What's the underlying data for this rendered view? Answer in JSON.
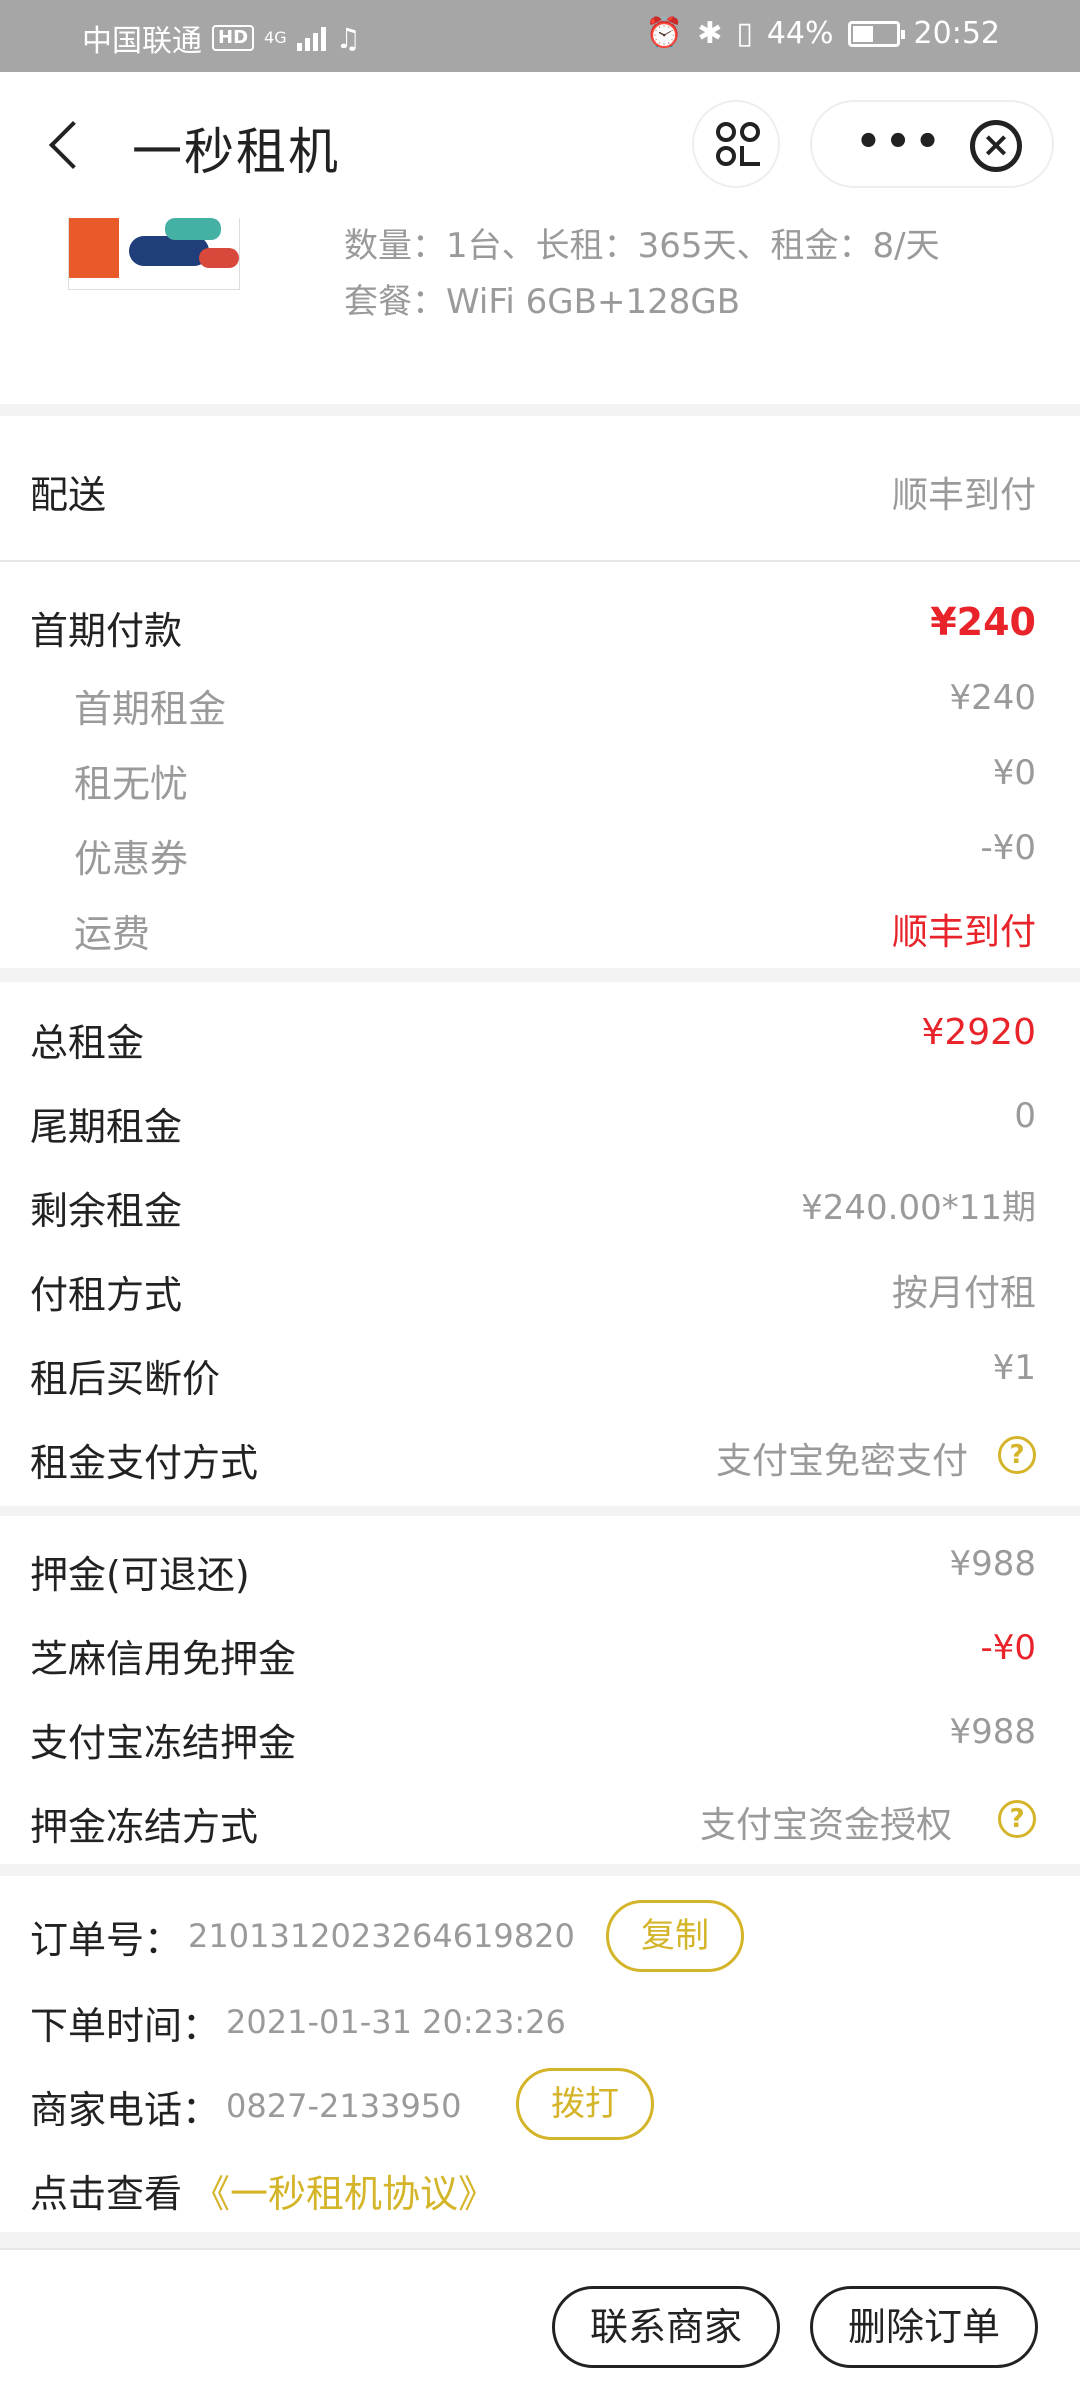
{
  "status_bar": {
    "carrier": "中国联通",
    "hd": "HD",
    "network": "4G",
    "battery": "44%",
    "time": "20:52"
  },
  "nav": {
    "title": "一秒租机",
    "more_label": "•••",
    "close_label": "×"
  },
  "product": {
    "line1": "数量：1台、长租：365天、租金：8/天",
    "line2": "套餐：WiFi 6GB+128GB"
  },
  "delivery": {
    "label": "配送",
    "value": "顺丰到付"
  },
  "first_payment": {
    "label": "首期付款",
    "value": "¥240",
    "items": [
      {
        "label": "首期租金",
        "value": "¥240"
      },
      {
        "label": "租无忧",
        "value": "¥0"
      },
      {
        "label": "优惠券",
        "value": "-¥0"
      },
      {
        "label": "运费",
        "value": "顺丰到付"
      }
    ]
  },
  "rent": {
    "rows": [
      {
        "label": "总租金",
        "value": "¥2920"
      },
      {
        "label": "尾期租金",
        "value": "0"
      },
      {
        "label": "剩余租金",
        "value": "¥240.00*11期"
      },
      {
        "label": "付租方式",
        "value": "按月付租"
      },
      {
        "label": "租后买断价",
        "value": "¥1"
      },
      {
        "label": "租金支付方式",
        "value": "支付宝免密支付"
      }
    ]
  },
  "deposit": {
    "rows": [
      {
        "label": "押金(可退还)",
        "value": "¥988"
      },
      {
        "label": "芝麻信用免押金",
        "value": "-¥0"
      },
      {
        "label": "支付宝冻结押金",
        "value": "¥988"
      },
      {
        "label": "押金冻结方式",
        "value": "支付宝资金授权"
      }
    ],
    "help_icon": "?"
  },
  "order": {
    "order_no_label": "订单号：",
    "order_no": "2101312023264619820",
    "copy_label": "复制",
    "time_label": "下单时间：",
    "time": "2021-01-31 20:23:26",
    "phone_label": "商家电话：",
    "phone": "0827-2133950",
    "call_label": "拨打",
    "agreement_prefix": "点击查看",
    "agreement_link": "《一秒租机协议》"
  },
  "bottom": {
    "contact_label": "联系商家",
    "delete_label": "删除订单"
  },
  "colors": {
    "accent": "#d4b429",
    "red": "#e8232a",
    "status_bar_bg": "#a6a6a6"
  }
}
